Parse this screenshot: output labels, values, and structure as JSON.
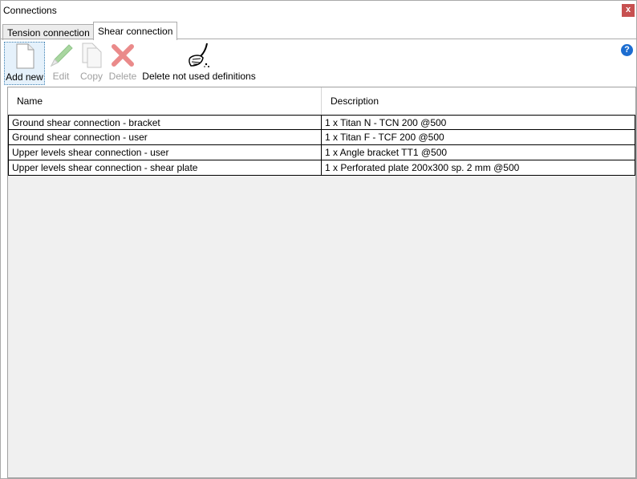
{
  "window": {
    "title": "Connections",
    "close_label": "x"
  },
  "tabs": [
    {
      "label": "Tension connection",
      "active": false
    },
    {
      "label": "Shear connection",
      "active": true
    }
  ],
  "toolbar": {
    "add_new": "Add new",
    "edit": "Edit",
    "copy": "Copy",
    "delete": "Delete",
    "delete_unused": "Delete not used definitions",
    "help": "?"
  },
  "table": {
    "columns": [
      "Name",
      "Description"
    ],
    "rows": [
      [
        "Ground shear connection - bracket",
        "1 x Titan N - TCN 200 @500"
      ],
      [
        "Ground shear connection - user",
        "1 x Titan F - TCF 200 @500"
      ],
      [
        "Upper levels shear connection - user",
        "1 x Angle bracket TT1 @500"
      ],
      [
        "Upper levels shear connection - shear plate",
        "1 x Perforated plate 200x300 sp. 2 mm @500"
      ]
    ]
  },
  "colors": {
    "delete_icon": "#e05050",
    "edit_icon": "#7ac27a",
    "help_icon": "#1c6dd0",
    "close_button": "#c75050"
  }
}
